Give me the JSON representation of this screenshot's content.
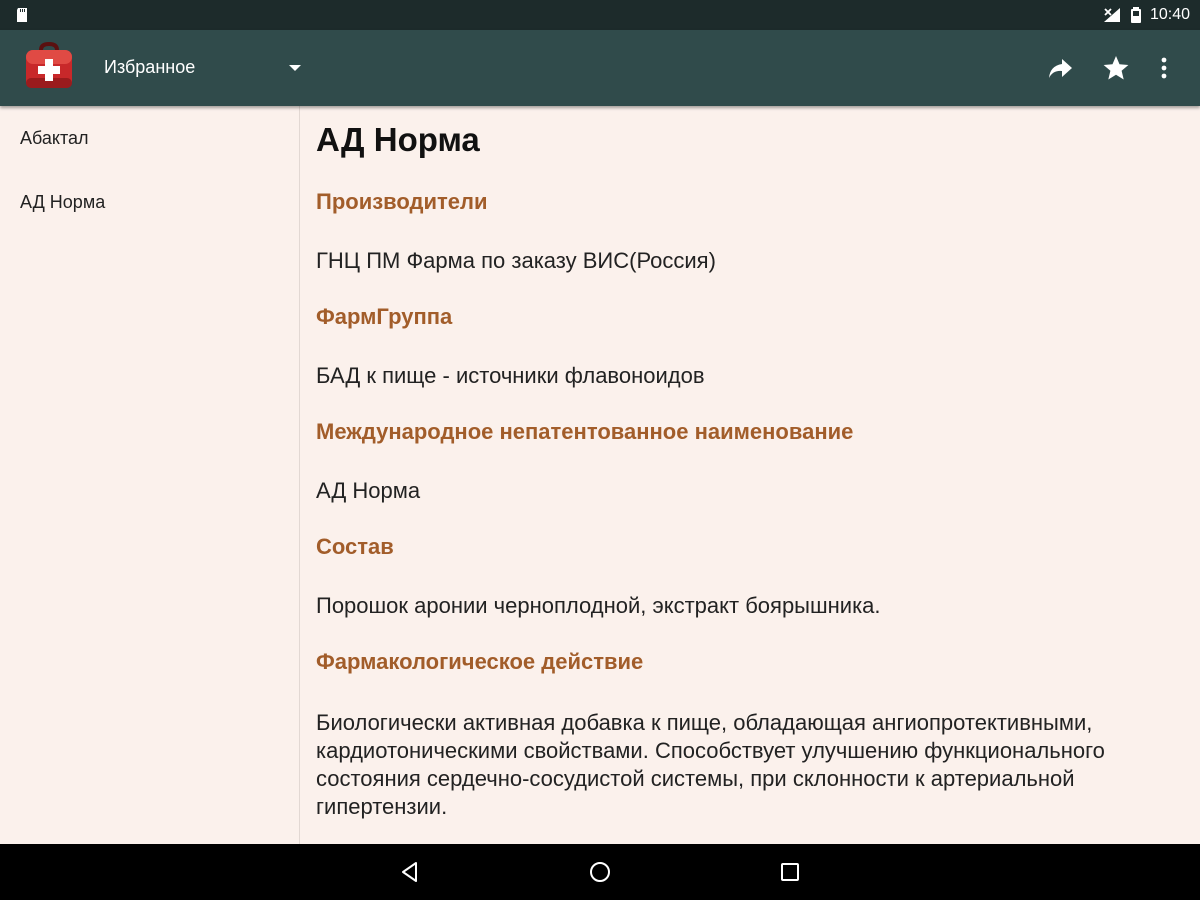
{
  "status_bar": {
    "time": "10:40"
  },
  "app_bar": {
    "title": "Избранное",
    "icons": {
      "logo": "first-aid-kit-icon",
      "dropdown": "arrow-drop-down-icon",
      "share": "share-icon",
      "favorite": "star-icon",
      "more": "more-vert-icon"
    }
  },
  "sidebar": {
    "items": [
      {
        "label": "Абактал"
      },
      {
        "label": "АД Норма"
      }
    ]
  },
  "detail": {
    "title": "АД Норма",
    "sections": [
      {
        "heading": "Производители",
        "text": "ГНЦ ПМ Фарма по заказу ВИС(Россия)"
      },
      {
        "heading": "ФармГруппа",
        "text": "БАД к пище - источники флавоноидов"
      },
      {
        "heading": "Международное непатентованное наименование",
        "text": "АД Норма"
      },
      {
        "heading": "Состав",
        "text": "Порошок аронии черноплодной, экстракт боярышника."
      },
      {
        "heading": "Фармакологическое действие",
        "text": "Биологически активная добавка к пище, обладающая ангиопротективными, кардиотоническими свойствами. Способствует улучшению функционального состояния сердечно-сосудистой системы, при склонности к артериальной гипертензии."
      }
    ]
  },
  "colors": {
    "status_bar": "#1d2b2b",
    "app_bar": "#304b4b",
    "background": "#fbf1ec",
    "heading": "#a25d2a",
    "text": "#222222"
  }
}
